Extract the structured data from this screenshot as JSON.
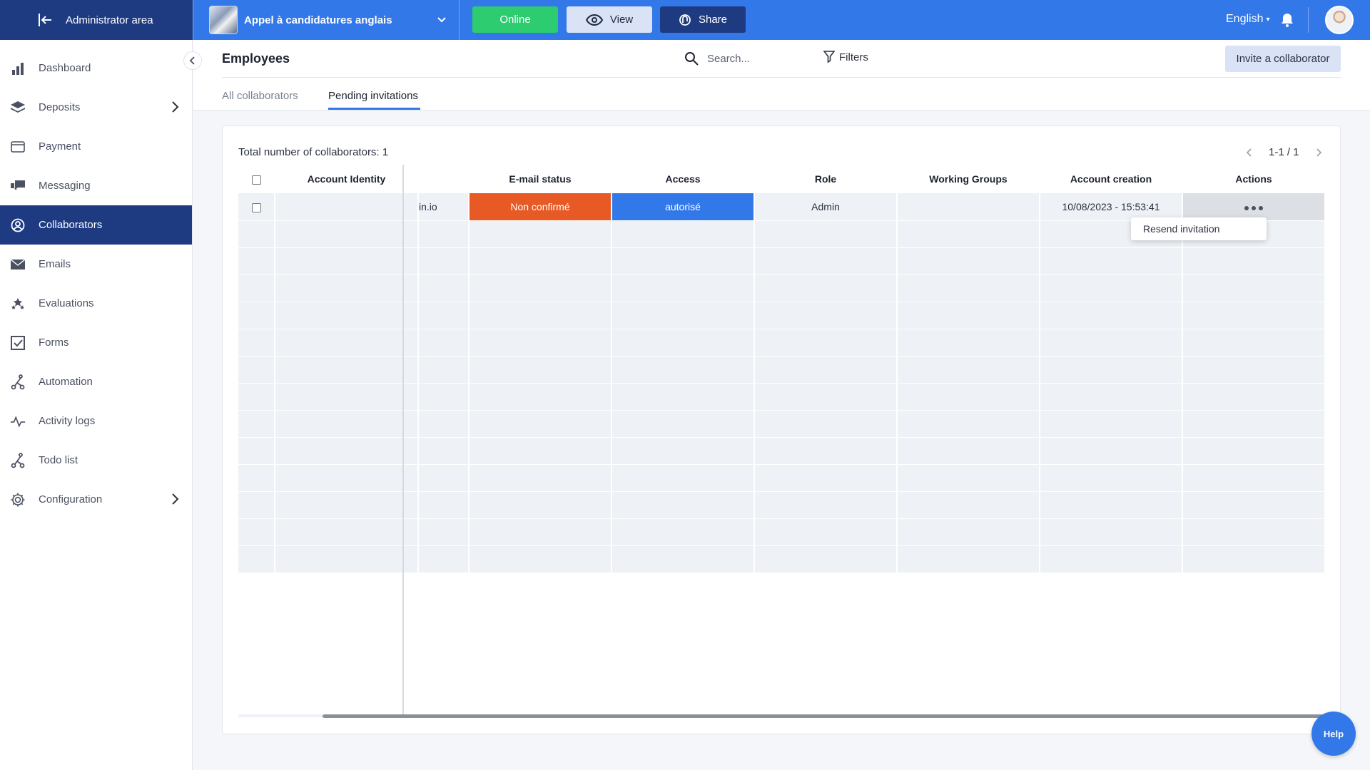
{
  "topbar": {
    "admin_label": "Administrator area",
    "project_name": "Appel à candidatures anglais",
    "online_label": "Online",
    "view_label": "View",
    "share_label": "Share",
    "language": "English"
  },
  "sidebar": {
    "items": [
      {
        "label": "Dashboard",
        "icon": "bar-chart-icon"
      },
      {
        "label": "Deposits",
        "icon": "layers-icon"
      },
      {
        "label": "Payment",
        "icon": "credit-card-icon"
      },
      {
        "label": "Messaging",
        "icon": "chat-icon"
      },
      {
        "label": "Collaborators",
        "icon": "user-circle-icon"
      },
      {
        "label": "Emails",
        "icon": "envelope-icon"
      },
      {
        "label": "Evaluations",
        "icon": "stars-icon"
      },
      {
        "label": "Forms",
        "icon": "checkbox-icon"
      },
      {
        "label": "Automation",
        "icon": "automation-icon"
      },
      {
        "label": "Activity logs",
        "icon": "pulse-icon"
      },
      {
        "label": "Todo list",
        "icon": "todo-icon"
      },
      {
        "label": "Configuration",
        "icon": "gear-icon"
      }
    ]
  },
  "header": {
    "title": "Employees",
    "search_placeholder": "Search...",
    "filters_label": "Filters",
    "invite_label": "Invite a collaborator",
    "tabs": [
      {
        "label": "All collaborators"
      },
      {
        "label": "Pending invitations"
      }
    ]
  },
  "panel": {
    "total_label": "Total number of collaborators: 1",
    "pagination": "1-1 / 1",
    "columns": [
      "Account Identity",
      "E-mail status",
      "Access",
      "Role",
      "Working Groups",
      "Account creation",
      "Actions"
    ],
    "row": {
      "email_partial": "in.io",
      "email_status": "Non confirmé",
      "access": "autorisé",
      "role": "Admin",
      "working_groups": "",
      "account_creation": "10/08/2023 - 15:53:41"
    },
    "dropdown_item": "Resend invitation"
  },
  "help_label": "Help",
  "colors": {
    "primary": "#3278e8",
    "navy": "#1e3b82",
    "online_green": "#2ecc71",
    "status_orange": "#e85a25"
  }
}
